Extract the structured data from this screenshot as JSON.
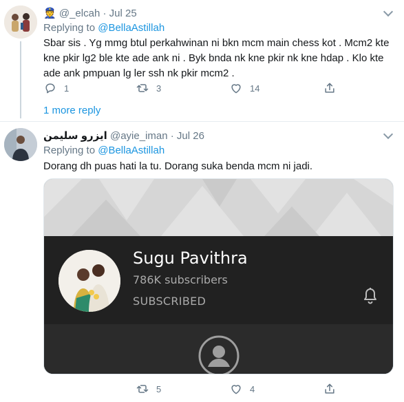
{
  "tweet1": {
    "display_name_emoji": "👮",
    "handle": "@_elcah",
    "separator": "·",
    "date": "Jul 25",
    "replying_label": "Replying to",
    "replying_handle": "@BellaAstillah",
    "lines": [
      "Sbar sis . Yg mmg btul perkahwinan ni bkn mcm main chess kot . Mcm2 kte",
      "kne pkir lg2 ble kte ade ank ni . Byk bnda nk kne pkir nk kne hdap . Klo kte",
      "ade ank pmpuan lg ler ssh nk pkir mcm2 ."
    ],
    "reply_count": "1",
    "retweet_count": "3",
    "like_count": "14",
    "more_replies": "1 more reply"
  },
  "tweet2": {
    "display_name": "ايزرو سليمن",
    "handle": "@ayie_iman",
    "separator": "·",
    "date": "Jul 26",
    "replying_label": "Replying to",
    "replying_handle": "@BellaAstillah",
    "text": "Dorang dh puas hati la tu. Dorang suka benda mcm ni jadi.",
    "retweet_count": "5",
    "like_count": "4"
  },
  "card": {
    "channel_name": "Sugu Pavithra",
    "subscribers": "786K subscribers",
    "status": "SUBSCRIBED"
  },
  "icons": {
    "reply": "reply-icon",
    "retweet": "retweet-icon",
    "like": "heart-icon",
    "share": "share-icon",
    "caret": "chevron-down-icon",
    "bell": "bell-icon",
    "user": "user-circle-icon"
  },
  "colors": {
    "link": "#1b95e0",
    "muted": "#657786",
    "text": "#14171a",
    "card_dark": "#212121"
  }
}
